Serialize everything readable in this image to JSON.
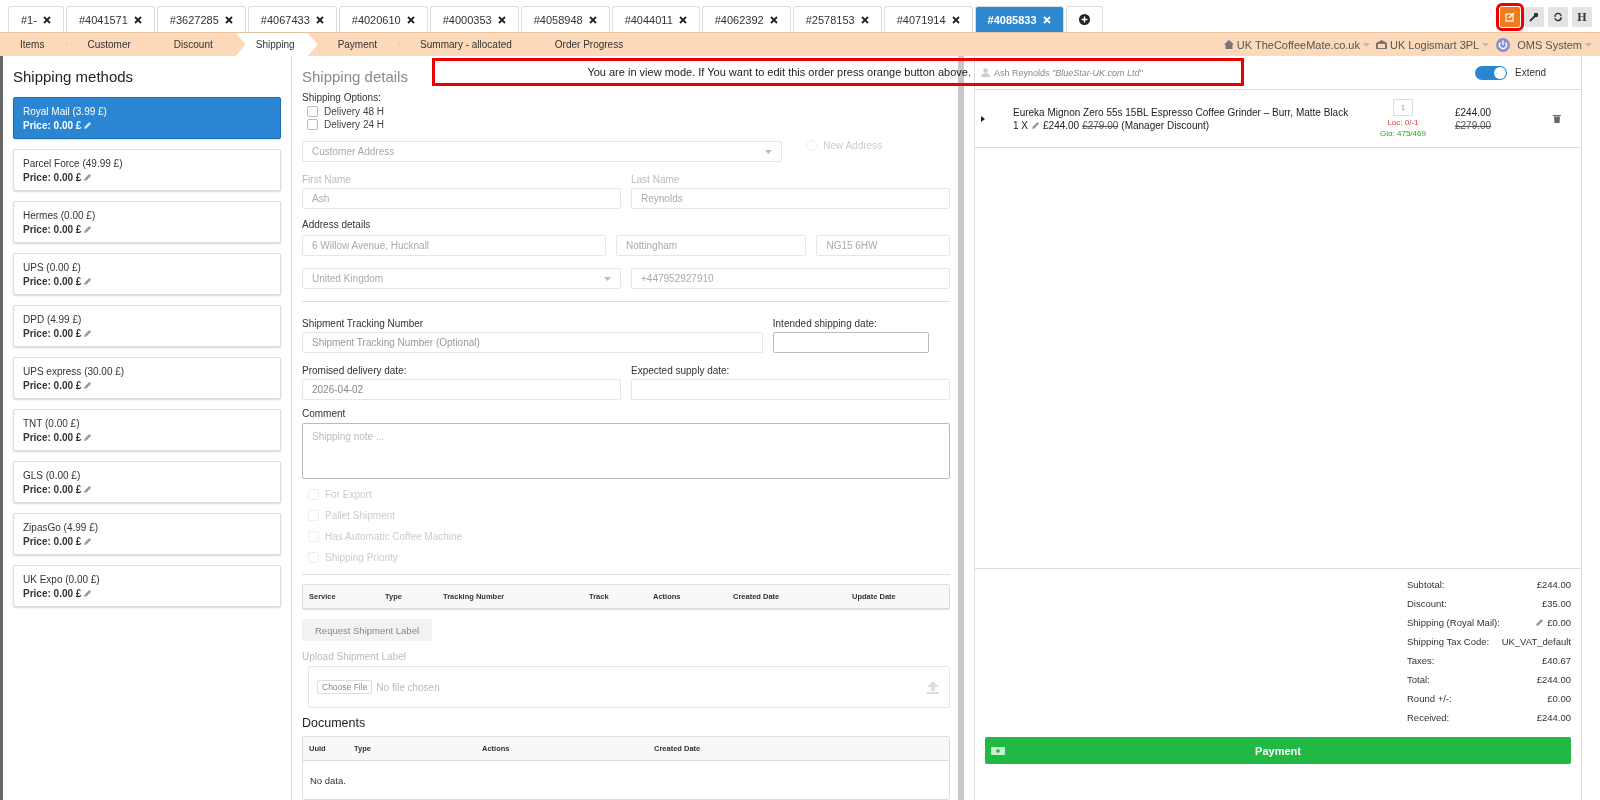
{
  "order_tabs": [
    {
      "label": "#1-",
      "selected": false
    },
    {
      "label": "#4041571",
      "selected": false
    },
    {
      "label": "#3627285",
      "selected": false
    },
    {
      "label": "#4067433",
      "selected": false
    },
    {
      "label": "#4020610",
      "selected": false
    },
    {
      "label": "#4000353",
      "selected": false
    },
    {
      "label": "#4058948",
      "selected": false
    },
    {
      "label": "#4044011",
      "selected": false
    },
    {
      "label": "#4062392",
      "selected": false
    },
    {
      "label": "#2578153",
      "selected": false
    },
    {
      "label": "#4071914",
      "selected": false
    },
    {
      "label": "#4085833",
      "selected": true
    }
  ],
  "toolbar_buttons": [
    {
      "kind": "edit",
      "highlighted": true
    },
    {
      "kind": "wrench",
      "highlighted": false
    },
    {
      "kind": "refresh",
      "highlighted": false
    },
    {
      "kind": "letter",
      "label": "H",
      "highlighted": false
    }
  ],
  "steps": [
    {
      "label": "Items",
      "selected": false
    },
    {
      "label": "Customer",
      "selected": false
    },
    {
      "label": "Discount",
      "selected": false
    },
    {
      "label": "Shipping",
      "selected": true
    },
    {
      "label": "Payment",
      "selected": false
    },
    {
      "label": "Summary - allocated",
      "selected": false
    },
    {
      "label": "Order Progress",
      "selected": false
    }
  ],
  "context": [
    {
      "kind": "home",
      "label": "UK TheCoffeeMate.co.uk"
    },
    {
      "kind": "building",
      "label": "UK Logismart 3PL"
    },
    {
      "kind": "power",
      "label": "OMS System"
    }
  ],
  "shipping_methods": {
    "title": "Shipping methods",
    "items": [
      {
        "name": "Royal Mail (3.99 £)",
        "price": "Price: 0.00 £",
        "selected": true
      },
      {
        "name": "Parcel Force (49.99 £)",
        "price": "Price: 0.00 £",
        "selected": false
      },
      {
        "name": "Hermes (0.00 £)",
        "price": "Price: 0.00 £",
        "selected": false
      },
      {
        "name": "UPS (0.00 £)",
        "price": "Price: 0.00 £",
        "selected": false
      },
      {
        "name": "DPD (4.99 £)",
        "price": "Price: 0.00 £",
        "selected": false
      },
      {
        "name": "UPS express (30.00 £)",
        "price": "Price: 0.00 £",
        "selected": false
      },
      {
        "name": "TNT (0.00 £)",
        "price": "Price: 0.00 £",
        "selected": false
      },
      {
        "name": "GLS (0.00 £)",
        "price": "Price: 0.00 £",
        "selected": false
      },
      {
        "name": "ZipasGo (4.99 £)",
        "price": "Price: 0.00 £",
        "selected": false
      },
      {
        "name": "UK Expo (0.00 £)",
        "price": "Price: 0.00 £",
        "selected": false
      }
    ]
  },
  "shipping_details": {
    "title": "Shipping details",
    "notice": "You are in view mode. If You want to edit this order press orange button above.",
    "options_label": "Shipping Options:",
    "options": [
      {
        "label": "Delivery 48 H",
        "checked": false
      },
      {
        "label": "Delivery 24 H",
        "checked": false
      }
    ],
    "customer_address": {
      "placeholder": "Customer Address"
    },
    "new_address": {
      "label": "New Address",
      "selected": false
    },
    "first_name_label": "First Name",
    "first_name": "Ash",
    "last_name_label": "Last Name",
    "last_name": "Reynolds",
    "address_label": "Address details",
    "street": "6 Willow Avenue, Hucknall",
    "city": "Nottingham",
    "postcode": "NG15 6HW",
    "country": "United Kingdom",
    "phone": "+447952927910",
    "tracking_label": "Shipment Tracking Number",
    "tracking": {
      "placeholder": "Shipment Tracking Number (Optional)"
    },
    "intended_label": "Intended shipping date:",
    "promised_label": "Promised delivery date:",
    "promised": "2026-04-02",
    "expected_label": "Expected supply date:",
    "comment_label": "Comment",
    "comment": {
      "placeholder": "Shipping note ..."
    },
    "flags": [
      {
        "label": "For Export",
        "checked": false
      },
      {
        "label": "Pallet Shipment",
        "checked": false
      },
      {
        "label": "Has Automatic Coffee Machine",
        "checked": false
      },
      {
        "label": "Shipping Priority",
        "checked": false
      }
    ],
    "shipments_columns": [
      "Service",
      "Type",
      "Tracking Number",
      "Track",
      "Actions",
      "Created Date",
      "Update Date"
    ],
    "request_button": "Request Shipment Label",
    "upload_label": "Upload Shipment Label",
    "file_button": "Choose File",
    "file_status": "No file chosen",
    "documents": {
      "title": "Documents",
      "columns": [
        "Uuid",
        "Type",
        "Actions",
        "Created Date"
      ],
      "empty": "No data."
    }
  },
  "cart": {
    "customer": "Ash Reynolds *\"BlueStar-UK.com Ltd\"*",
    "extend": {
      "label": "Extend",
      "on": true
    },
    "items": [
      {
        "name": "Eureka Mignon Zero 55s 15BL Espresso Coffee Grinder – Burr, Matte Black",
        "qty_line": "1 X",
        "price": "£244.00",
        "old_price": "£279.00",
        "note": "(Manager Discount)",
        "quantity": "1",
        "loc": "Loc: 0/-1",
        "glo": "Glo: 475/469",
        "total": "£244.00",
        "total_old": "£279.00"
      }
    ],
    "totals": [
      {
        "label": "Subtotal:",
        "value": "£244.00",
        "editable": false
      },
      {
        "label": "Discount:",
        "value": "£35.00",
        "editable": false
      },
      {
        "label": "Shipping (Royal Mail):",
        "value": "£0.00",
        "editable": true
      },
      {
        "label": "Shipping Tax Code:",
        "value": "UK_VAT_default",
        "editable": false
      },
      {
        "label": "Taxes:",
        "value": "£40.67",
        "editable": false
      },
      {
        "label": "Total:",
        "value": "£244.00",
        "editable": false
      },
      {
        "label": "Round +/-:",
        "value": "£0.00",
        "editable": false
      },
      {
        "label": "Received:",
        "value": "£244.00",
        "editable": false
      }
    ],
    "payment_button": "Payment"
  }
}
